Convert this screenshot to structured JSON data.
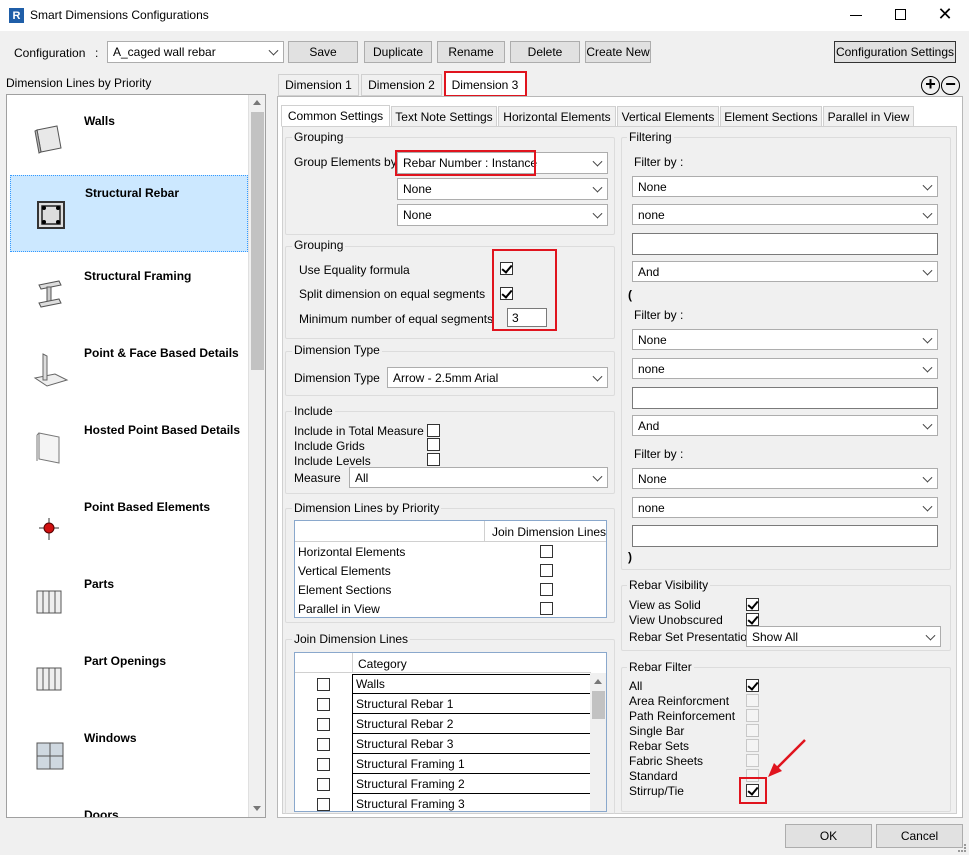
{
  "window": {
    "app_icon": "R",
    "title": "Smart Dimensions Configurations"
  },
  "toolbar": {
    "config_label": "Configuration",
    "config_colon": ":",
    "config_value": "A_caged wall rebar",
    "save": "Save",
    "duplicate": "Duplicate",
    "rename": "Rename",
    "delete": "Delete",
    "create_new": "Create New",
    "config_settings": "Configuration Settings"
  },
  "left": {
    "header": "Dimension Lines by Priority",
    "items": [
      {
        "label": "Walls",
        "icon": "wall-icon"
      },
      {
        "label": "Structural Rebar",
        "icon": "rebar-icon"
      },
      {
        "label": "Structural Framing",
        "icon": "beam-icon"
      },
      {
        "label": "Point & Face Based Details",
        "icon": "face-detail-icon"
      },
      {
        "label": "Hosted Point Based Details",
        "icon": "panel-icon"
      },
      {
        "label": "Point Based Elements",
        "icon": "point-icon"
      },
      {
        "label": "Parts",
        "icon": "parts-icon"
      },
      {
        "label": "Part Openings",
        "icon": "part-openings-icon"
      },
      {
        "label": "Windows",
        "icon": "window-icon"
      },
      {
        "label": "Doors",
        "icon": "door-icon"
      }
    ]
  },
  "dim_tabs": [
    "Dimension 1",
    "Dimension 2",
    "Dimension 3"
  ],
  "sub_tabs": [
    "Common Settings",
    "Text Note Settings",
    "Horizontal Elements",
    "Vertical Elements",
    "Element Sections",
    "Parallel in View"
  ],
  "grouping1": {
    "title": "Grouping",
    "group_by_label": "Group Elements by",
    "group_by_value": "Rebar Number : Instance",
    "second": "None",
    "third": "None"
  },
  "grouping2": {
    "title": "Grouping",
    "equality": "Use Equality formula",
    "split": "Split dimension on equal segments",
    "min_label": "Minimum number of equal segments",
    "min_value": "3"
  },
  "dim_type": {
    "title": "Dimension Type",
    "label": "Dimension Type",
    "value": "Arrow - 2.5mm Arial"
  },
  "include": {
    "title": "Include",
    "total": "Include in Total Measure",
    "grids": "Include Grids",
    "levels": "Include Levels",
    "measure_label": "Measure",
    "measure_value": "All"
  },
  "priority": {
    "title": "Dimension Lines by Priority",
    "col": "Join Dimension Lines",
    "rows": [
      "Horizontal Elements",
      "Vertical Elements",
      "Element Sections",
      "Parallel in View"
    ]
  },
  "join": {
    "title": "Join Dimension Lines",
    "col": "Category",
    "rows": [
      "Walls",
      "Structural Rebar 1",
      "Structural Rebar 2",
      "Structural Rebar 3",
      "Structural Framing 1",
      "Structural Framing 2",
      "Structural Framing 3"
    ]
  },
  "filtering": {
    "title": "Filtering",
    "filter_by": "Filter by :",
    "none_upper": "None",
    "none_lower": "none",
    "and": "And",
    "open_paren": "(",
    "close_paren": ")"
  },
  "rebar_vis": {
    "title": "Rebar Visibility",
    "solid": "View as Solid",
    "unobscured": "View Unobscured",
    "set_pres_label": "Rebar Set Presentation",
    "set_pres_value": "Show All"
  },
  "rebar_filter": {
    "title": "Rebar Filter",
    "items": [
      "All",
      "Area Reinforcment",
      "Path Reinforcement",
      "Single Bar",
      "Rebar Sets",
      "Fabric Sheets",
      "Standard",
      "Stirrup/Tie"
    ]
  },
  "footer": {
    "ok": "OK",
    "cancel": "Cancel"
  },
  "colors": {
    "highlight": "#e0141e",
    "selection": "#cce8ff"
  }
}
